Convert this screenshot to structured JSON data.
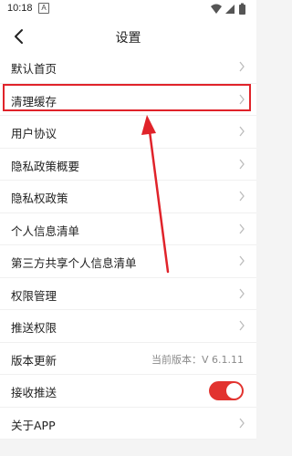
{
  "status_bar": {
    "time": "10:18",
    "notification_glyph": "A",
    "icons": [
      "wifi-icon",
      "signal-icon",
      "battery-icon"
    ]
  },
  "header": {
    "title": "设置",
    "back_icon": "back-arrow-icon"
  },
  "settings": {
    "items": [
      {
        "label": "默认首页",
        "type": "link"
      },
      {
        "label": "清理缓存",
        "type": "link"
      },
      {
        "label": "用户协议",
        "type": "link"
      },
      {
        "label": "隐私政策概要",
        "type": "link"
      },
      {
        "label": "隐私权政策",
        "type": "link"
      },
      {
        "label": "个人信息清单",
        "type": "link"
      },
      {
        "label": "第三方共享个人信息清单",
        "type": "link"
      },
      {
        "label": "权限管理",
        "type": "link"
      },
      {
        "label": "推送权限",
        "type": "link"
      },
      {
        "label": "版本更新",
        "type": "value",
        "value": "当前版本：V 6.1.11"
      },
      {
        "label": "接收推送",
        "type": "toggle",
        "state": "on"
      },
      {
        "label": "关于APP",
        "type": "link"
      }
    ]
  },
  "annotation": {
    "highlight_color": "#e0232a",
    "highlighted_item": "清理缓存"
  },
  "colors": {
    "accent": "#e2332f",
    "background": "#f4f4f4"
  }
}
